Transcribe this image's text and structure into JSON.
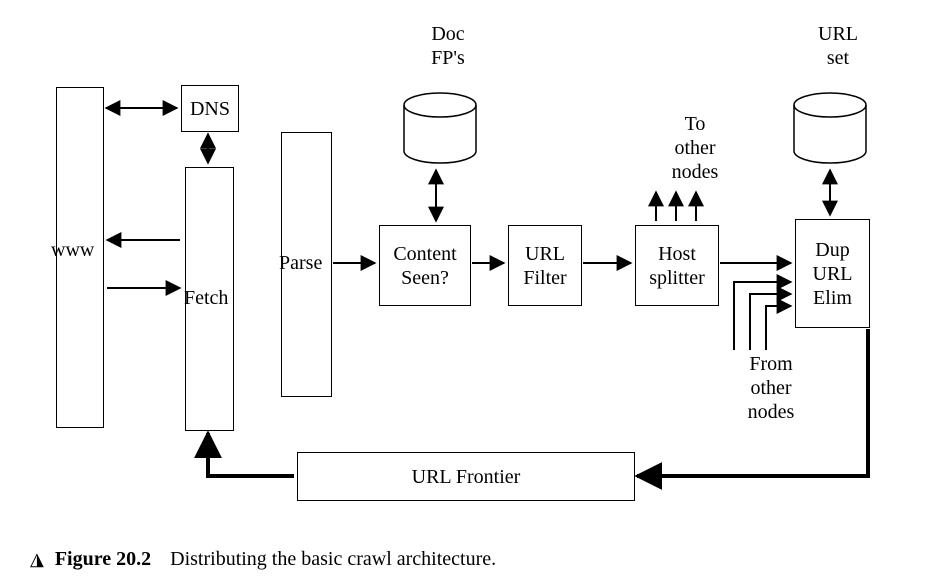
{
  "boxes": {
    "www": "www",
    "dns": "DNS",
    "fetch": "Fetch",
    "parse": "Parse",
    "content_seen": "Content\nSeen?",
    "url_filter": "URL\nFilter",
    "host_splitter": "Host\nsplitter",
    "dup_url_elim": "Dup\nURL\nElim",
    "url_frontier": "URL Frontier"
  },
  "labels": {
    "doc_fps": "Doc\nFP's",
    "url_set": "URL\nset",
    "to_other_nodes": "To\nother\nnodes",
    "from_other_nodes": "From\nother\nnodes"
  },
  "caption": {
    "marker": "◮",
    "fig": "Figure 20.2",
    "text": "Distributing the basic crawl architecture."
  }
}
